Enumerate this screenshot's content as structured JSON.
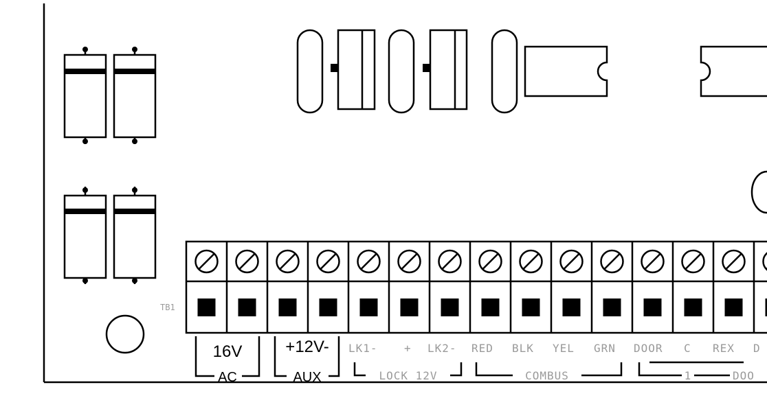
{
  "board": {
    "terminal_block_id": "TB1",
    "terminals": [
      {
        "label": "",
        "group": "ac"
      },
      {
        "label": "",
        "group": "ac"
      },
      {
        "label": "",
        "group": "aux"
      },
      {
        "label": "",
        "group": "aux"
      },
      {
        "label": "LK1-",
        "group": "lock"
      },
      {
        "label": "+",
        "group": "lock"
      },
      {
        "label": "LK2-",
        "group": "lock"
      },
      {
        "label": "RED",
        "group": "combus"
      },
      {
        "label": "BLK",
        "group": "combus"
      },
      {
        "label": "YEL",
        "group": "combus"
      },
      {
        "label": "GRN",
        "group": "combus"
      },
      {
        "label": "DOOR",
        "group": "door1"
      },
      {
        "label": "C",
        "group": "door1"
      },
      {
        "label": "REX",
        "group": "door1"
      },
      {
        "label": "D",
        "group": "door2"
      }
    ],
    "groups": {
      "ac": {
        "top": "16V",
        "bottom": "AC"
      },
      "aux": {
        "top": "+12V-",
        "bottom": "AUX"
      },
      "lock": {
        "name": "LOCK 12V"
      },
      "combus": {
        "name": "COMBUS"
      },
      "door": {
        "number": "1",
        "name": "DOO"
      }
    }
  }
}
